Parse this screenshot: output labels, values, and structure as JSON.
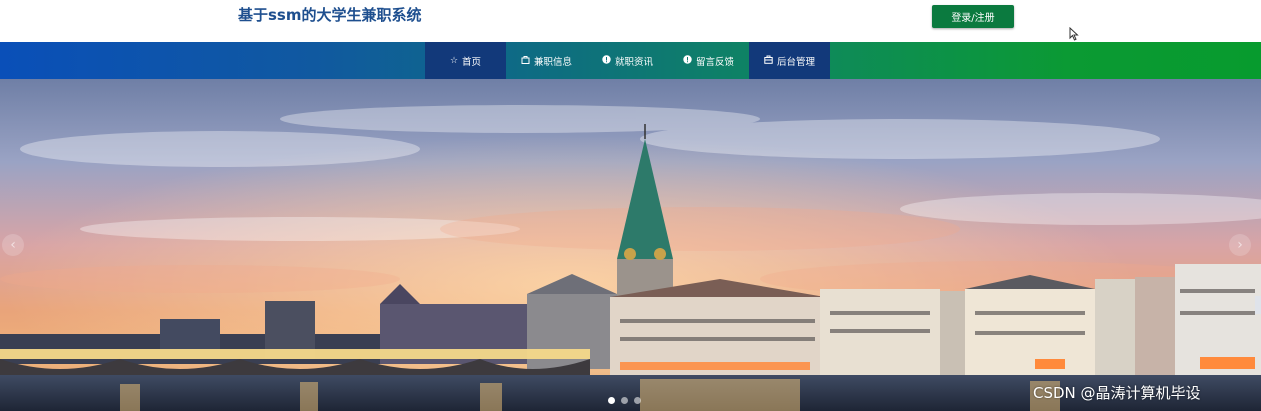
{
  "header": {
    "site_title": "基于ssm的大学生兼职系统",
    "login_button": "登录/注册"
  },
  "nav": {
    "items": [
      {
        "label": "首页",
        "icon": "star-icon"
      },
      {
        "label": "兼职信息",
        "icon": "bag-icon"
      },
      {
        "label": "就职资讯",
        "icon": "info-icon"
      },
      {
        "label": "留言反馈",
        "icon": "info-icon"
      },
      {
        "label": "后台管理",
        "icon": "briefcase-icon"
      }
    ]
  },
  "carousel": {
    "prev_arrow": "‹",
    "next_arrow": "›",
    "slide_count": 3,
    "active_slide": 1
  },
  "watermark": "CSDN @晶涛计算机毕设",
  "colors": {
    "brand_title": "#1e4f8f",
    "login_button": "#0b7a3f",
    "nav_gradient_start": "#0a4fb8",
    "nav_gradient_end": "#079b2e",
    "nav_active": "#12397a"
  }
}
